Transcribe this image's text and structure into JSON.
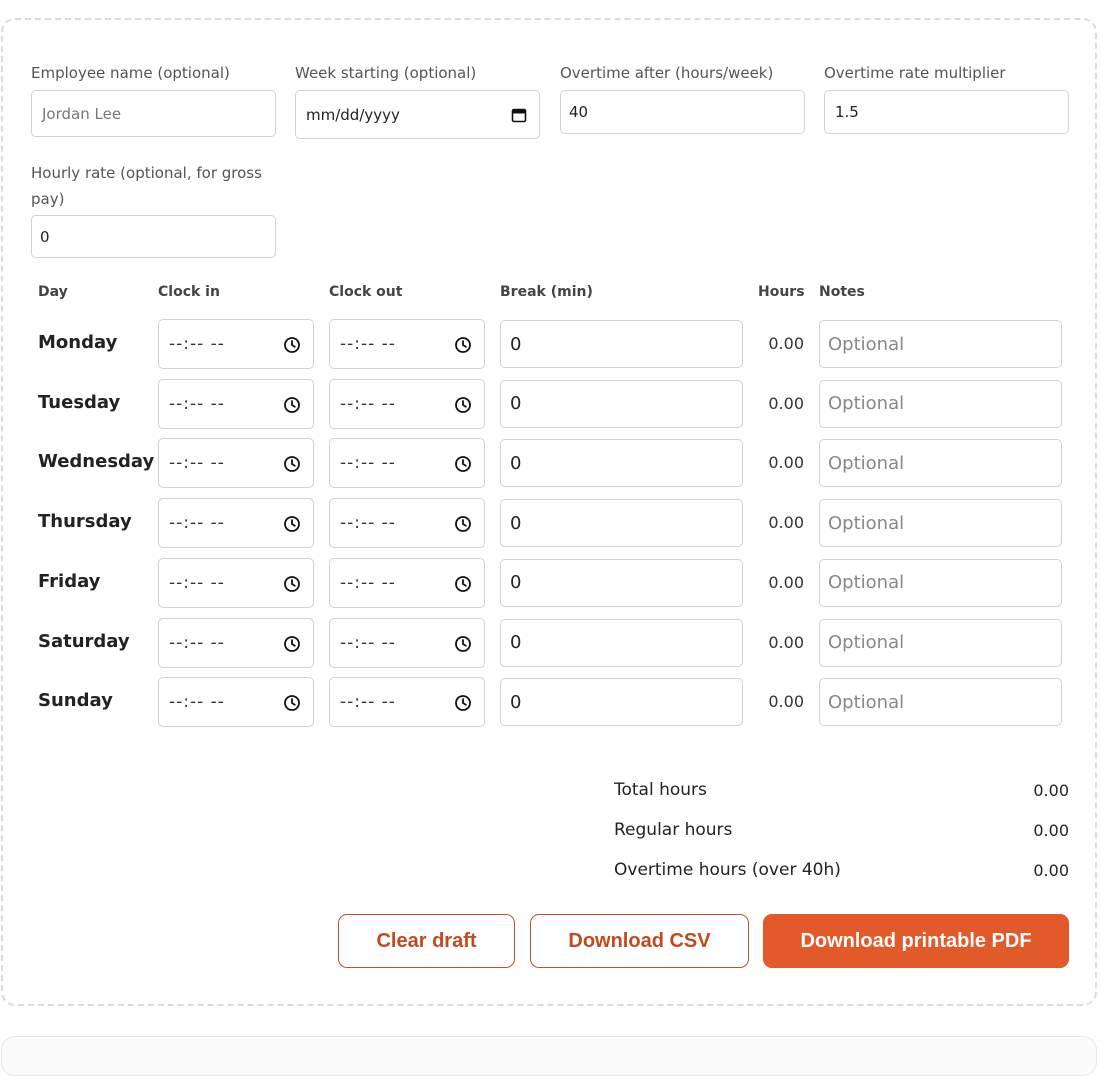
{
  "form": {
    "employee_label": "Employee name (optional)",
    "employee_placeholder": "Jordan Lee",
    "week_label": "Week starting (optional)",
    "week_placeholder": "mm/dd/yyyy",
    "ot_after_label": "Overtime after (hours/week)",
    "ot_after_value": "40",
    "ot_mult_label": "Overtime rate multiplier",
    "ot_mult_value": "1.5",
    "rate_label_line1": "Hourly rate (optional, for gross",
    "rate_label_line2": "pay)",
    "rate_value": "0"
  },
  "table": {
    "headers": {
      "day": "Day",
      "clock_in": "Clock in",
      "clock_out": "Clock out",
      "break": "Break (min)",
      "hours": "Hours",
      "notes": "Notes"
    },
    "time_placeholder": "--:-- --",
    "notes_placeholder": "Optional",
    "rows": [
      {
        "day": "Monday",
        "break": "0",
        "hours": "0.00"
      },
      {
        "day": "Tuesday",
        "break": "0",
        "hours": "0.00"
      },
      {
        "day": "Wednesday",
        "break": "0",
        "hours": "0.00"
      },
      {
        "day": "Thursday",
        "break": "0",
        "hours": "0.00"
      },
      {
        "day": "Friday",
        "break": "0",
        "hours": "0.00"
      },
      {
        "day": "Saturday",
        "break": "0",
        "hours": "0.00"
      },
      {
        "day": "Sunday",
        "break": "0",
        "hours": "0.00"
      }
    ]
  },
  "summary": {
    "total_label": "Total hours",
    "total_value": "0.00",
    "regular_label": "Regular hours",
    "regular_value": "0.00",
    "overtime_label": "Overtime hours (over 40h)",
    "overtime_value": "0.00"
  },
  "actions": {
    "clear_label": "Clear draft",
    "csv_label": "Download CSV",
    "pdf_label": "Download printable PDF"
  },
  "colors": {
    "accent": "#e2592a",
    "accent_text": "#c24a1e"
  },
  "icons": {
    "time_field": "clock-icon",
    "date_field": "calendar-icon"
  }
}
